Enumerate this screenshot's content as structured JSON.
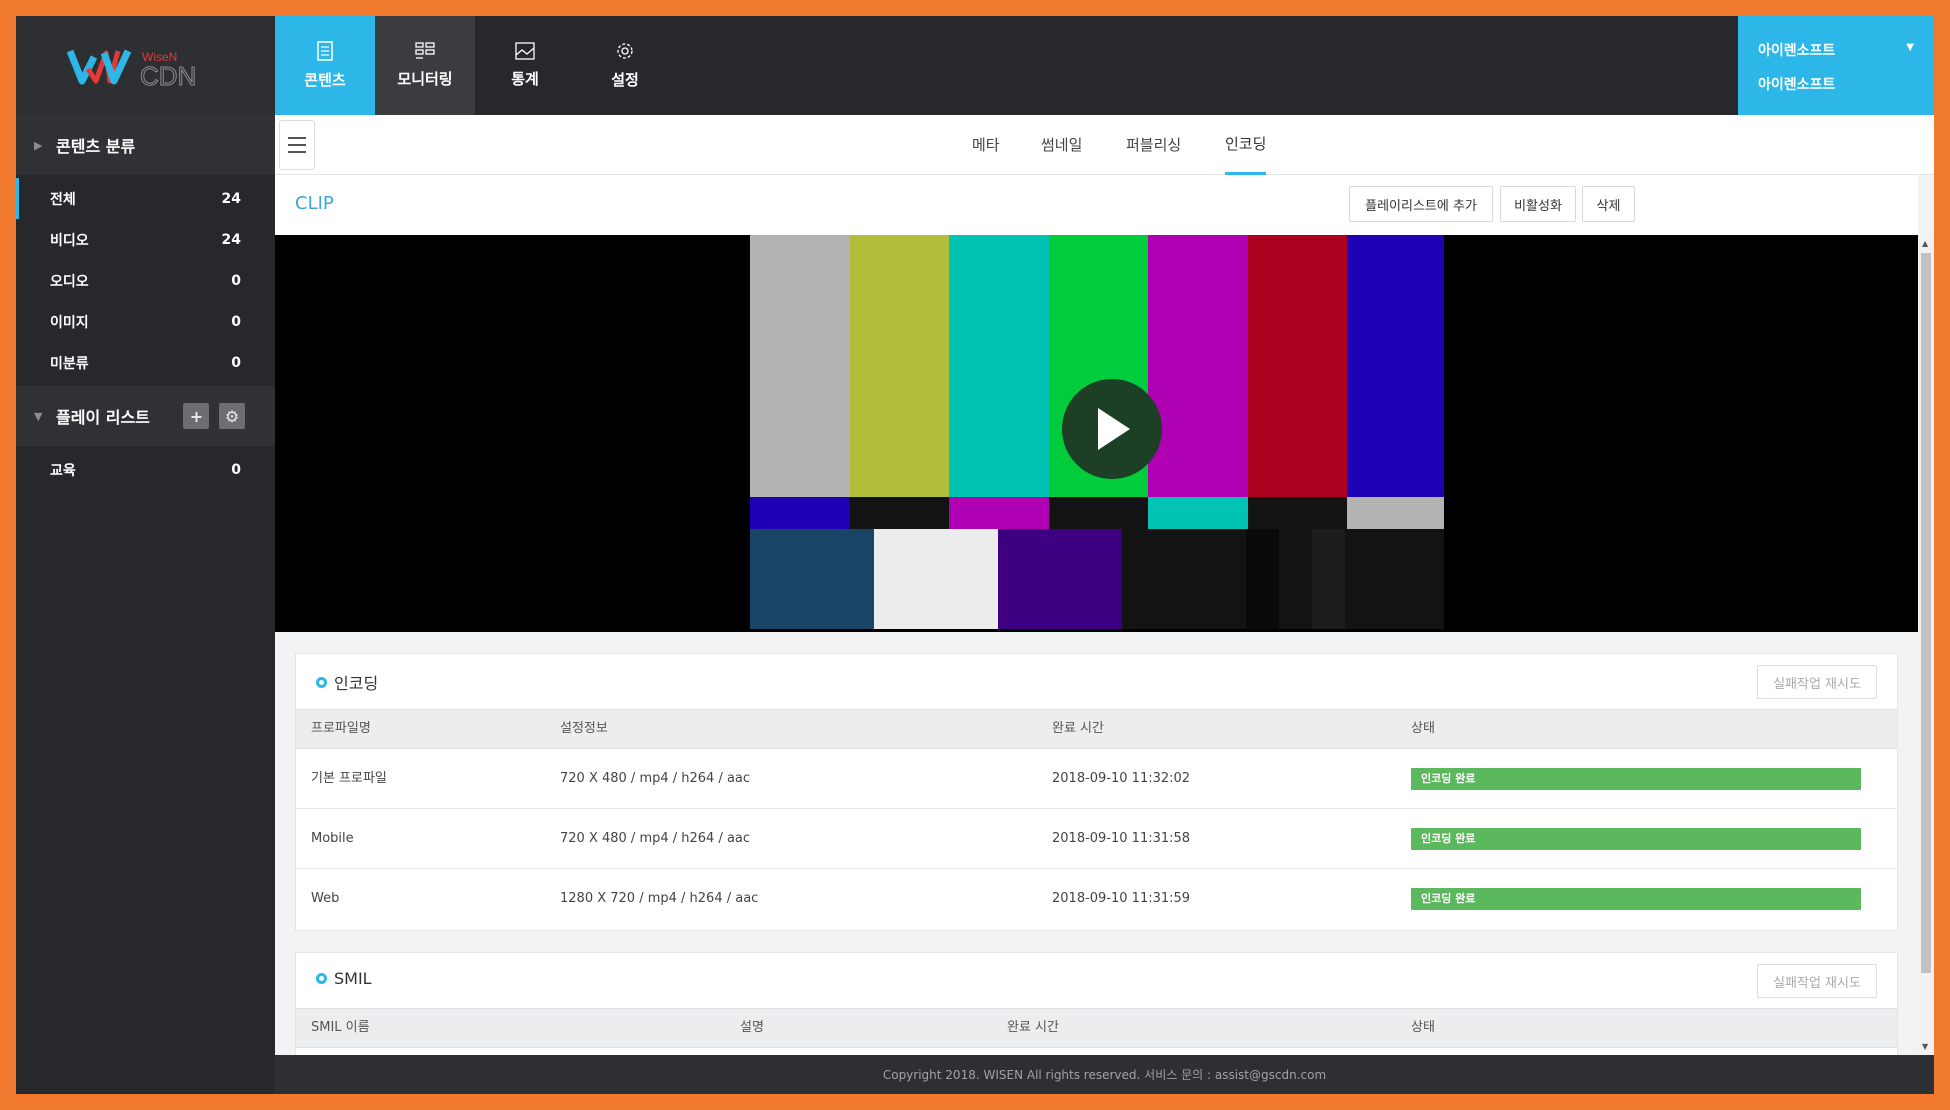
{
  "logo": {
    "brand_small": "WiseN",
    "brand_large": "CDN"
  },
  "sidebar": {
    "content_section": "콘텐츠 분류",
    "items": [
      {
        "label": "전체",
        "count": "24"
      },
      {
        "label": "비디오",
        "count": "24"
      },
      {
        "label": "오디오",
        "count": "0"
      },
      {
        "label": "이미지",
        "count": "0"
      },
      {
        "label": "미분류",
        "count": "0"
      }
    ],
    "playlist_section": "플레이 리스트",
    "playlists": [
      {
        "label": "교육",
        "count": "0"
      }
    ]
  },
  "nav": {
    "tabs": [
      {
        "label": "콘텐츠",
        "icon": "document-icon"
      },
      {
        "label": "모니터링",
        "icon": "dashboard-icon"
      },
      {
        "label": "통계",
        "icon": "image-icon"
      },
      {
        "label": "설정",
        "icon": "gear-icon"
      }
    ]
  },
  "user": {
    "company": "아이렌소프트",
    "name": "아이렌소프트"
  },
  "subtabs": [
    "메타",
    "썸네일",
    "퍼블리싱",
    "인코딩"
  ],
  "clip": {
    "title": "CLIP",
    "add_playlist_btn": "플레이리스트에 추가",
    "deactivate_btn": "비활성화",
    "delete_btn": "삭제"
  },
  "encoding": {
    "title": "인코딩",
    "retry_btn": "실패작업 재시도",
    "headers": [
      "프로파일명",
      "설정정보",
      "완료 시간",
      "상태"
    ],
    "rows": [
      {
        "profile": "기본 프로파일",
        "settings": "720 X 480 / mp4 / h264 / aac",
        "time": "2018-09-10 11:32:02",
        "status": "인코딩 완료"
      },
      {
        "profile": "Mobile",
        "settings": "720 X 480 / mp4 / h264 / aac",
        "time": "2018-09-10 11:31:58",
        "status": "인코딩 완료"
      },
      {
        "profile": "Web",
        "settings": "1280 X 720 / mp4 / h264 / aac",
        "time": "2018-09-10 11:31:59",
        "status": "인코딩 완료"
      }
    ]
  },
  "smil": {
    "title": "SMIL",
    "retry_btn": "실패작업 재시도",
    "headers": [
      "SMIL 이름",
      "설명",
      "완료 시간",
      "상태"
    ]
  },
  "footer": "Copyright 2018. WISEN All rights reserved. 서비스 문의 : assist@gscdn.com",
  "colors": {
    "accent": "#2cb7e8",
    "success": "#5cb85c",
    "sidebar": "#26282c"
  }
}
